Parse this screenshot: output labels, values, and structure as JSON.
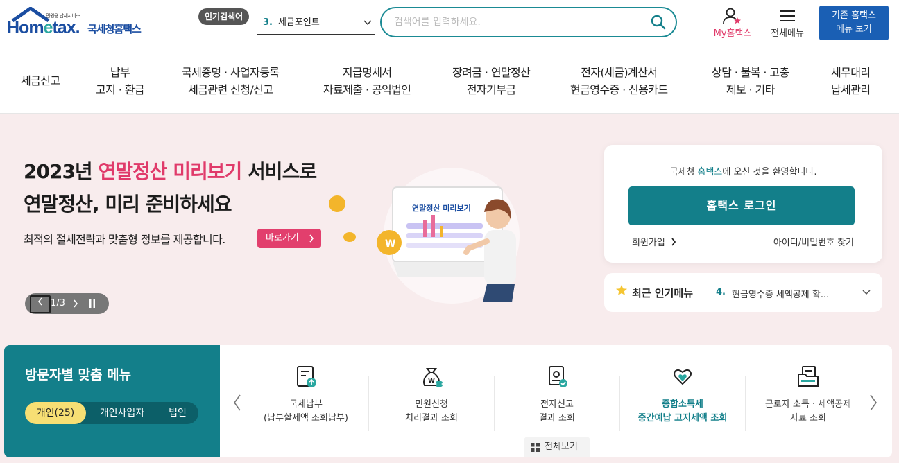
{
  "header": {
    "logo": {
      "tagline": "민원용 납세서비스",
      "en": "Hometax",
      "ko": "국세청홈택스"
    },
    "popular_badge": "인기검색어",
    "popular_num": "3.",
    "popular_term": "세금포인트",
    "search": {
      "placeholder": "검색어를 입력하세요."
    },
    "my_label": "My홈택스",
    "menu_label": "전체메뉴",
    "old_btn_line1": "기존 홈택스",
    "old_btn_line2": "메뉴 보기"
  },
  "gnb": [
    {
      "line1": "세금신고",
      "line2": ""
    },
    {
      "line1": "납부",
      "line2": "고지 · 환급"
    },
    {
      "line1": "국세증명 · 사업자등록",
      "line2": "세금관련 신청/신고"
    },
    {
      "line1": "지급명세서",
      "line2": "자료제출 · 공익법인"
    },
    {
      "line1": "장려금 · 연말정산",
      "line2": "전자기부금"
    },
    {
      "line1": "전자(세금)계산서",
      "line2": "현금영수증 · 신용카드"
    },
    {
      "line1": "상담 · 불복 · 고충",
      "line2": "제보 · 기타"
    },
    {
      "line1": "세무대리",
      "line2": "납세관리"
    }
  ],
  "hero": {
    "title_a": "2023년 ",
    "title_hl": "연말정산 미리보기",
    "title_b": " 서비스로",
    "title_line2": "연말정산, 미리 준비하세요",
    "desc": "최적의 절세전략과 맞춤형 정보를 제공합니다.",
    "go_label": "바로가기",
    "screen_label": "연말정산 미리보기",
    "slider_page": "1/3"
  },
  "login": {
    "welcome_a": "국세청 ",
    "welcome_hl": "홈택스",
    "welcome_b": "에 오신 것을 환영합니다.",
    "button": "홈택스 로그인",
    "join": "회원가입",
    "find": "아이디/비밀번호 찾기"
  },
  "recent": {
    "title": "최근 인기메뉴",
    "num": "4.",
    "item": "현금영수증 세액공제 확..."
  },
  "visitor": {
    "title": "방문자별 맞춤 메뉴",
    "tabs": [
      "개인(25)",
      "개인사업자",
      "법인"
    ]
  },
  "quick": [
    {
      "l1": "국세납부",
      "l2": "(납부할세액 조회납부)"
    },
    {
      "l1": "민원신청",
      "l2": "처리결과 조회"
    },
    {
      "l1": "전자신고",
      "l2": "결과 조회"
    },
    {
      "l1": "종합소득세",
      "l2": "중간예납 고지세액 조회"
    },
    {
      "l1": "근로자 소득 · 세액공제",
      "l2": "자료 조회"
    }
  ],
  "allview_label": "전체보기",
  "colors": {
    "teal": "#137f8a",
    "pink": "#e03a6a",
    "blue": "#1a5fb4",
    "hero_bg": "#f8eced"
  }
}
